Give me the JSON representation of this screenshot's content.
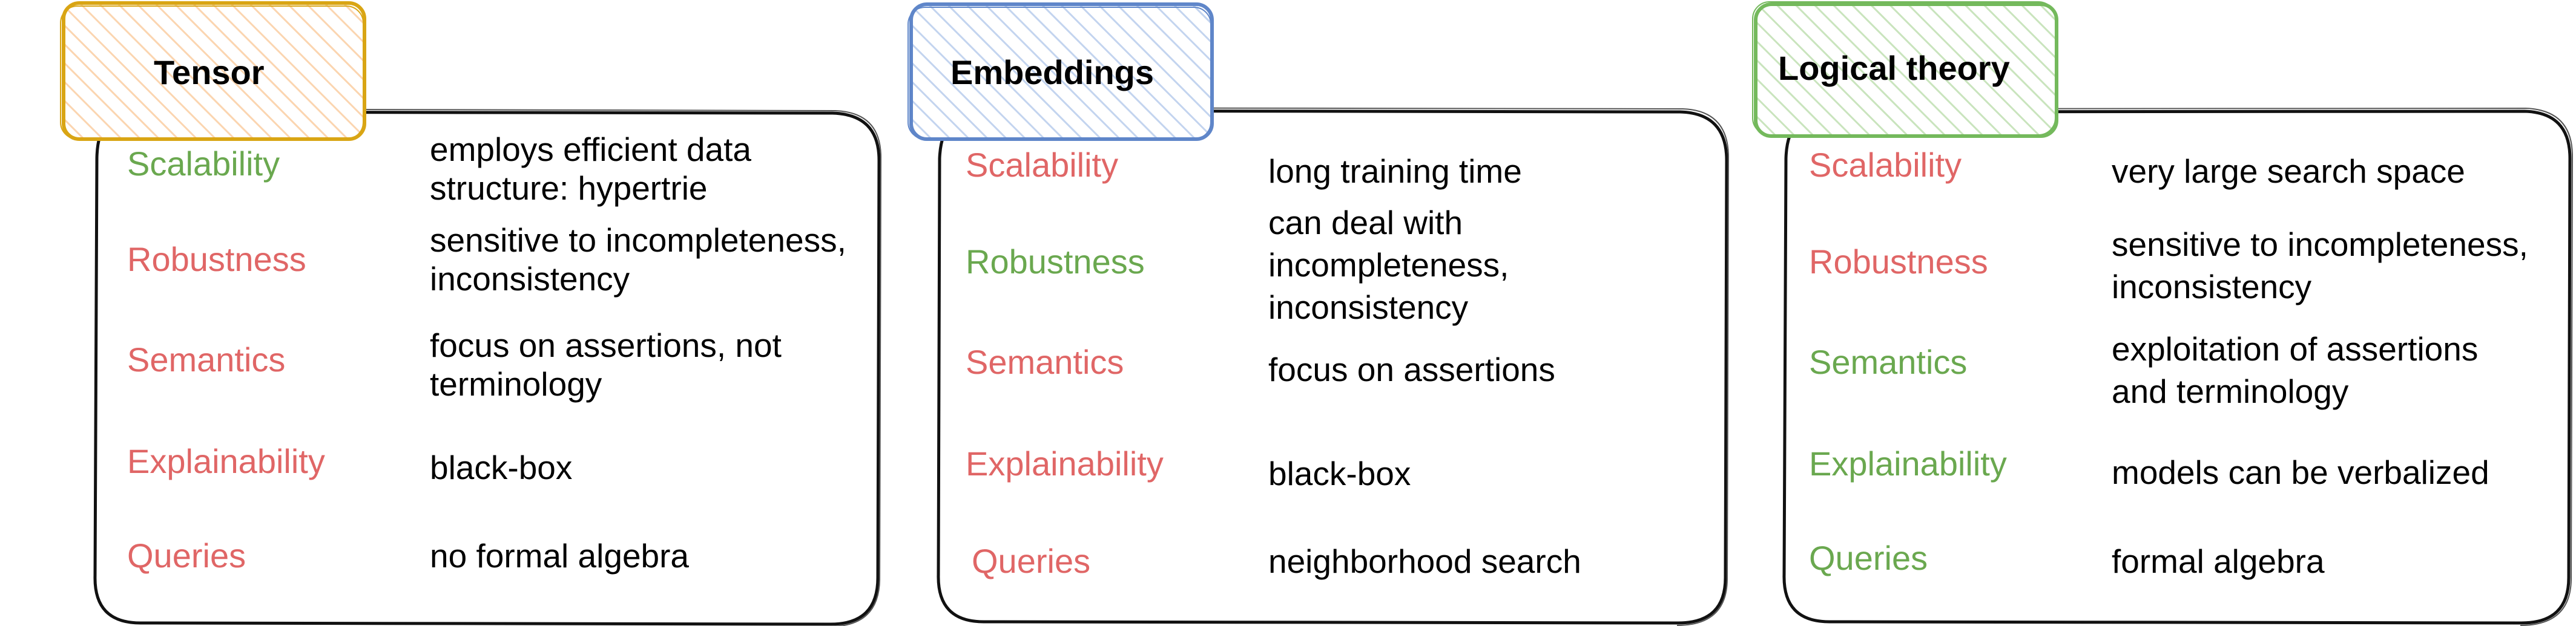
{
  "colors": {
    "good": "#6aa84f",
    "bad": "#e06666",
    "text": "#000000",
    "tensor_accent": "#d9a514",
    "tensor_hatch": "#fbd5b0",
    "embeddings_accent": "#5f86c9",
    "embeddings_hatch": "#c3d4ef",
    "logical_accent": "#74b95c",
    "logical_hatch": "#c9e4bd"
  },
  "panels": [
    {
      "title": "Tensor",
      "rows": [
        {
          "label": "Scalability",
          "status": "good",
          "desc": [
            "employs efficient data",
            "structure: hypertrie"
          ]
        },
        {
          "label": "Robustness",
          "status": "bad",
          "desc": [
            "sensitive to incompleteness,",
            "inconsistency"
          ]
        },
        {
          "label": "Semantics",
          "status": "bad",
          "desc": [
            "focus on assertions, not",
            "terminology"
          ]
        },
        {
          "label": "Explainability",
          "status": "bad",
          "desc": [
            "black-box"
          ]
        },
        {
          "label": "Queries",
          "status": "bad",
          "desc": [
            "no formal algebra"
          ]
        }
      ]
    },
    {
      "title": "Embeddings",
      "rows": [
        {
          "label": "Scalability",
          "status": "bad",
          "desc": [
            "long training time"
          ]
        },
        {
          "label": "Robustness",
          "status": "good",
          "desc": [
            "can deal with",
            "incompleteness,",
            "inconsistency"
          ]
        },
        {
          "label": "Semantics",
          "status": "bad",
          "desc": [
            "focus on assertions"
          ]
        },
        {
          "label": "Explainability",
          "status": "bad",
          "desc": [
            "black-box"
          ]
        },
        {
          "label": "Queries",
          "status": "bad",
          "desc": [
            "neighborhood search"
          ]
        }
      ]
    },
    {
      "title": "Logical theory",
      "rows": [
        {
          "label": "Scalability",
          "status": "bad",
          "desc": [
            "very large search space"
          ]
        },
        {
          "label": "Robustness",
          "status": "bad",
          "desc": [
            "sensitive to incompleteness,",
            "inconsistency"
          ]
        },
        {
          "label": "Semantics",
          "status": "good",
          "desc": [
            "exploitation of assertions",
            "and terminology"
          ]
        },
        {
          "label": "Explainability",
          "status": "good",
          "desc": [
            "models can be verbalized"
          ]
        },
        {
          "label": "Queries",
          "status": "good",
          "desc": [
            "formal algebra"
          ]
        }
      ]
    }
  ]
}
